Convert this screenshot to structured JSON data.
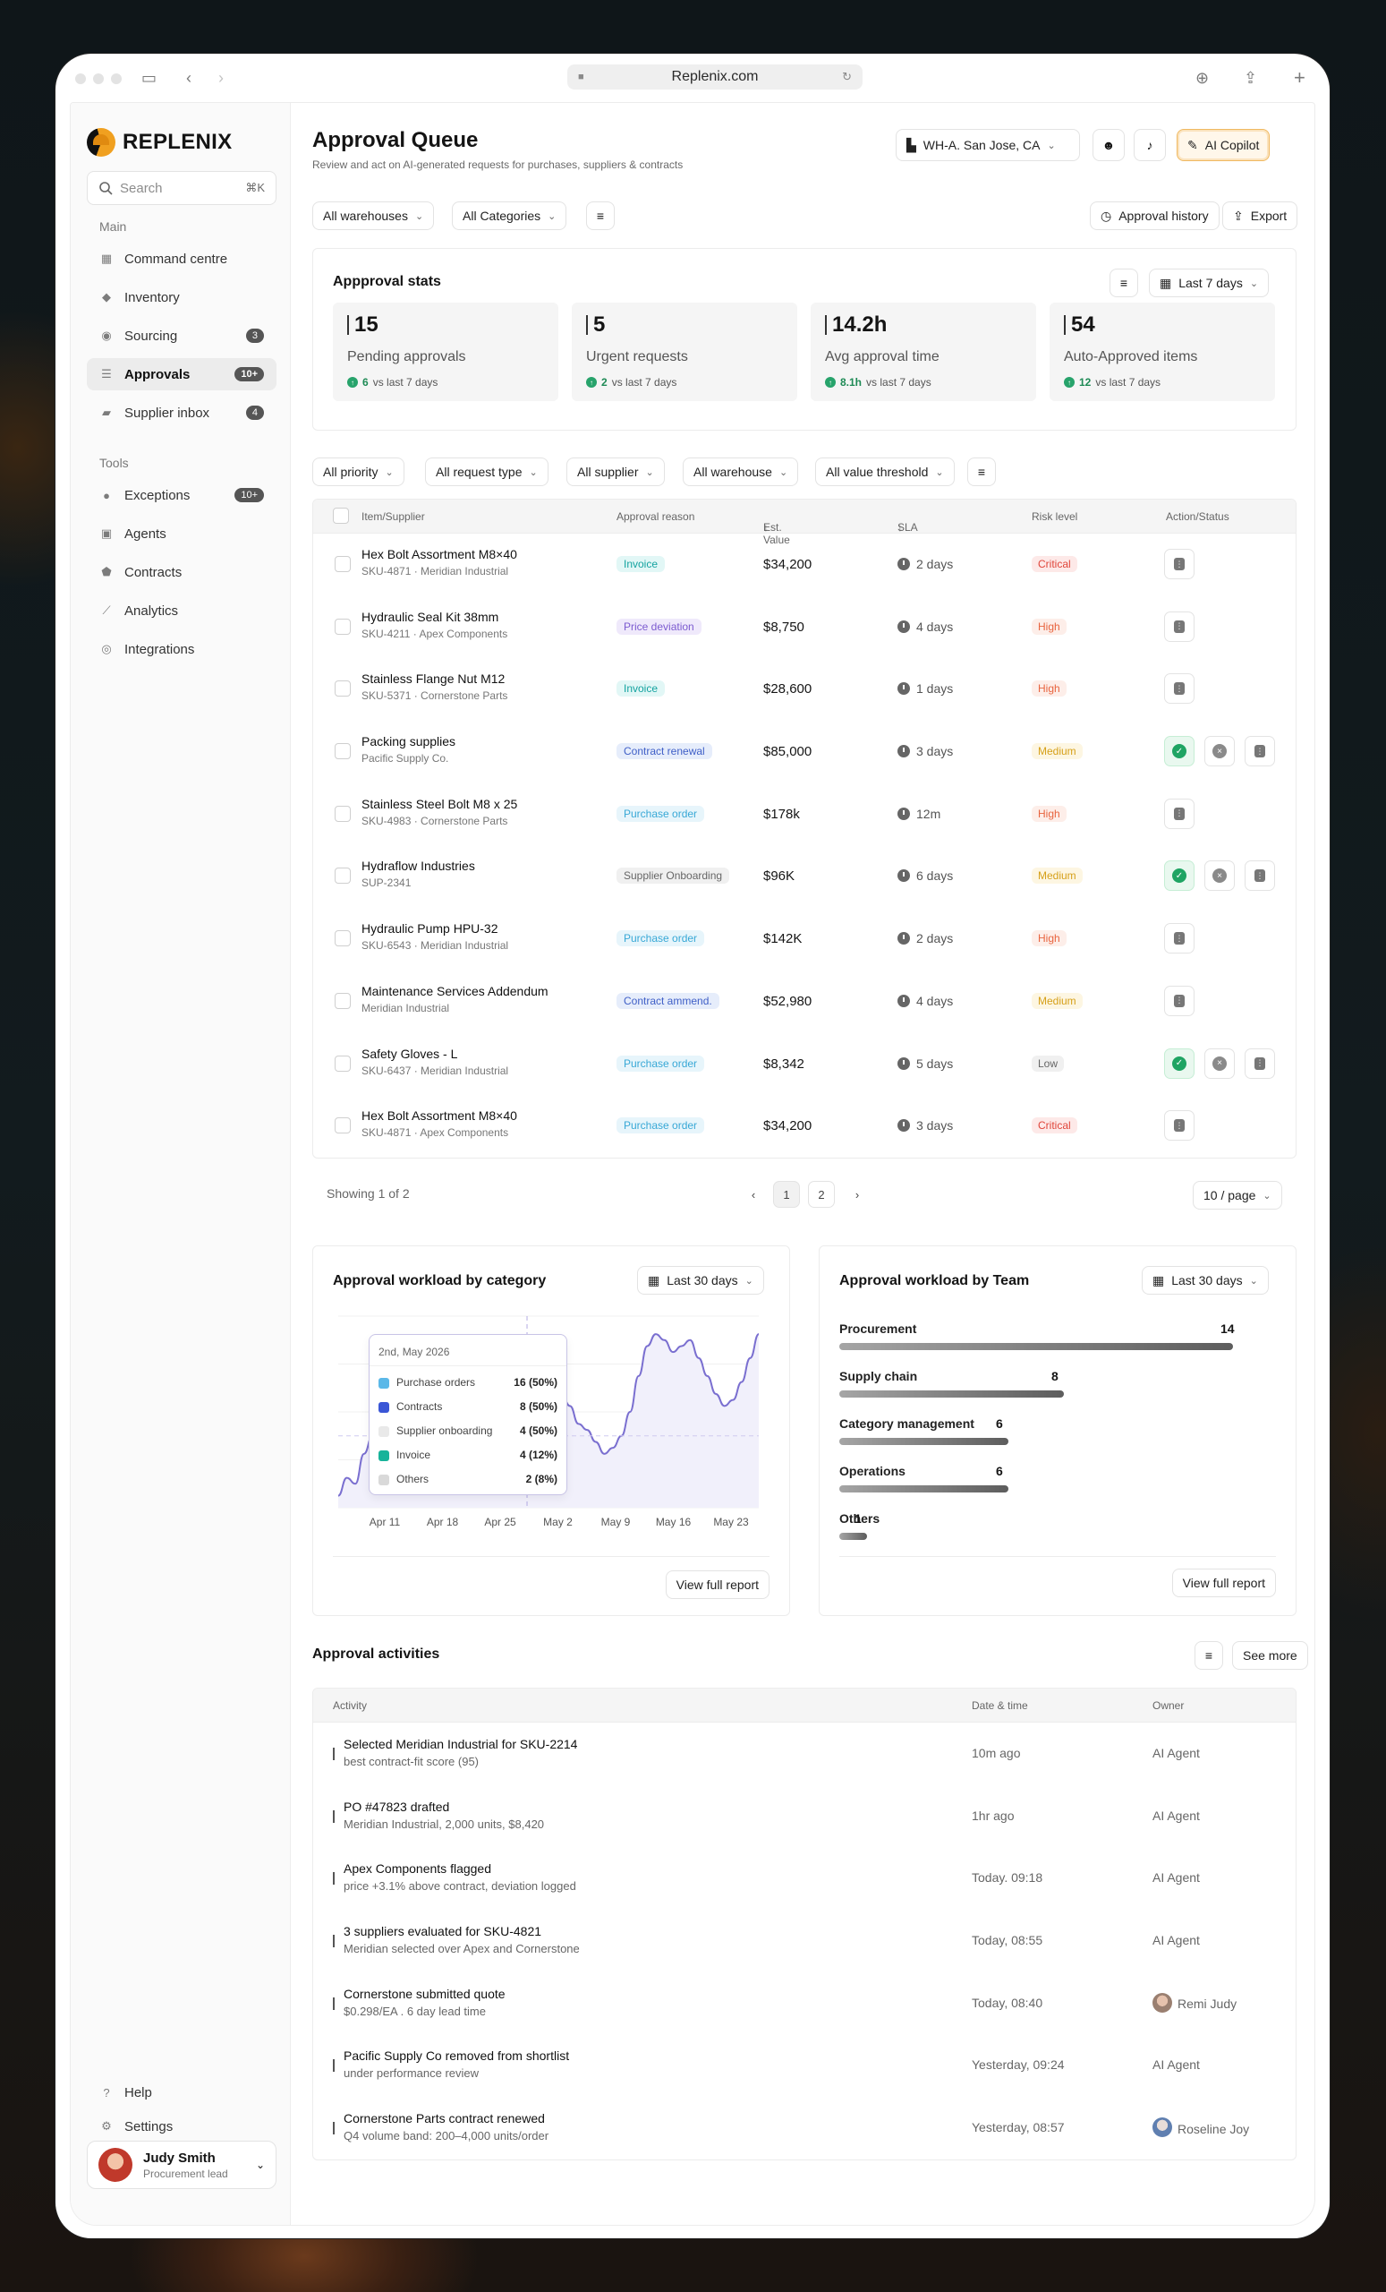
{
  "browser": {
    "url": "Replenix.com"
  },
  "brand": {
    "name": "REPLENIX"
  },
  "search": {
    "placeholder": "Search",
    "shortcut": "⌘K"
  },
  "sidebar": {
    "main_label": "Main",
    "tools_label": "Tools",
    "main_items": [
      {
        "label": "Command centre",
        "icon": "grid-icon"
      },
      {
        "label": "Inventory",
        "icon": "cube-icon"
      },
      {
        "label": "Sourcing",
        "icon": "sourcing-icon",
        "badge": "3"
      },
      {
        "label": "Approvals",
        "icon": "checklist-icon",
        "badge": "10+",
        "active": true
      },
      {
        "label": "Supplier inbox",
        "icon": "chat-icon",
        "badge": "4"
      }
    ],
    "tool_items": [
      {
        "label": "Exceptions",
        "icon": "alert-icon",
        "badge": "10+"
      },
      {
        "label": "Agents",
        "icon": "agent-icon"
      },
      {
        "label": "Contracts",
        "icon": "shield-icon"
      },
      {
        "label": "Analytics",
        "icon": "chart-icon"
      },
      {
        "label": "Integrations",
        "icon": "integration-icon"
      }
    ],
    "help": "Help",
    "settings": "Settings",
    "user": {
      "name": "Judy Smith",
      "role": "Procurement lead"
    }
  },
  "header": {
    "title": "Approval Queue",
    "subtitle": "Review and act on AI-generated requests for purchases, suppliers & contracts",
    "warehouse": "WH-A. San Jose, CA",
    "copilot": "AI Copilot"
  },
  "filters_top": {
    "warehouses": "All warehouses",
    "categories": "All Categories",
    "history": "Approval history",
    "export": "Export"
  },
  "stats": {
    "title": "Appproval stats",
    "range": "Last 7 days",
    "items": [
      {
        "value": "15",
        "label": "Pending approvals",
        "delta": "6",
        "delta_text": "vs last 7 days"
      },
      {
        "value": "5",
        "label": "Urgent requests",
        "delta": "2",
        "delta_text": "vs last 7 days"
      },
      {
        "value": "14.2h",
        "label": "Avg approval time",
        "delta": "8.1h",
        "delta_text": "vs last 7 days"
      },
      {
        "value": "54",
        "label": "Auto-Approved items",
        "delta": "12",
        "delta_text": "vs last 7 days"
      }
    ]
  },
  "filters_table": {
    "priority": "All priority",
    "request": "All request type",
    "supplier": "All supplier",
    "warehouse": "All warehouse",
    "threshold": "All value threshold"
  },
  "table": {
    "headers": {
      "item": "Item/Supplier",
      "reason": "Approval reason",
      "value": "Est. Value",
      "sla": "SLA",
      "risk": "Risk level",
      "action": "Action/Status"
    },
    "rows": [
      {
        "name": "Hex Bolt Assortment M8×40",
        "sub": "SKU-4871 · Meridian Industrial",
        "reason": "Invoice",
        "reason_kind": "teal",
        "value": "$34,200",
        "sla": "2 days",
        "risk": "Critical",
        "risk_kind": "critical",
        "actions": "more"
      },
      {
        "name": "Hydraulic Seal Kit 38mm",
        "sub": "SKU-4211 · Apex Components",
        "reason": "Price deviation",
        "reason_kind": "purple",
        "value": "$8,750",
        "sla": "4 days",
        "risk": "High",
        "risk_kind": "high",
        "actions": "more"
      },
      {
        "name": "Stainless Flange Nut M12",
        "sub": "SKU-5371 · Cornerstone Parts",
        "reason": "Invoice",
        "reason_kind": "teal",
        "value": "$28,600",
        "sla": "1 days",
        "risk": "High",
        "risk_kind": "high",
        "actions": "more"
      },
      {
        "name": "Packing supplies",
        "sub": "Pacific Supply Co.",
        "reason": "Contract renewal",
        "reason_kind": "indigo",
        "value": "$85,000",
        "sla": "3 days",
        "risk": "Medium",
        "risk_kind": "medium",
        "actions": "full"
      },
      {
        "name": "Stainless Steel Bolt M8 x 25",
        "sub": "SKU-4983 · Cornerstone Parts",
        "reason": "Purchase order",
        "reason_kind": "sky",
        "value": "$178k",
        "sla": "12m",
        "risk": "High",
        "risk_kind": "high",
        "actions": "more"
      },
      {
        "name": "Hydraflow Industries",
        "sub": "SUP-2341",
        "reason": "Supplier Onboarding",
        "reason_kind": "gray",
        "value": "$96K",
        "sla": "6 days",
        "risk": "Medium",
        "risk_kind": "medium",
        "actions": "full"
      },
      {
        "name": "Hydraulic Pump HPU-32",
        "sub": "SKU-6543 · Meridian Industrial",
        "reason": "Purchase order",
        "reason_kind": "sky",
        "value": "$142K",
        "sla": "2 days",
        "risk": "High",
        "risk_kind": "high",
        "actions": "more"
      },
      {
        "name": "Maintenance Services Addendum",
        "sub": "Meridian Industrial",
        "reason": "Contract ammend.",
        "reason_kind": "indigo",
        "value": "$52,980",
        "sla": "4 days",
        "risk": "Medium",
        "risk_kind": "medium",
        "actions": "more"
      },
      {
        "name": "Safety Gloves - L",
        "sub": "SKU-6437 · Meridian Industrial",
        "reason": "Purchase order",
        "reason_kind": "sky",
        "value": "$8,342",
        "sla": "5 days",
        "risk": "Low",
        "risk_kind": "low",
        "actions": "full"
      },
      {
        "name": "Hex Bolt Assortment M8×40",
        "sub": "SKU-4871 · Apex Components",
        "reason": "Purchase order",
        "reason_kind": "sky",
        "value": "$34,200",
        "sla": "3 days",
        "risk": "Critical",
        "risk_kind": "critical",
        "actions": "more"
      }
    ]
  },
  "pagination": {
    "showing": "Showing 1 of 2",
    "pages": [
      "1",
      "2"
    ],
    "per_page": "10 / page"
  },
  "workload_category": {
    "title": "Approval workload by category",
    "range": "Last 30 days",
    "tooltip": {
      "date": "2nd, May 2026",
      "rows": [
        {
          "label": "Purchase orders",
          "value": "16 (50%)",
          "color": "#5bb8e8"
        },
        {
          "label": "Contracts",
          "value": "8 (50%)",
          "color": "#3a56d6"
        },
        {
          "label": "Supplier onboarding",
          "value": "4 (50%)",
          "color": "#e9e9e9"
        },
        {
          "label": "Invoice",
          "value": "4 (12%)",
          "color": "#17b39a"
        },
        {
          "label": "Others",
          "value": "2 (8%)",
          "color": "#d9d9d9"
        }
      ]
    },
    "report": "View full report"
  },
  "workload_team": {
    "title": "Approval workload by Team",
    "range": "Last 30 days",
    "report": "View full report",
    "bars": [
      {
        "label": "Procurement",
        "value": 14
      },
      {
        "label": "Supply chain",
        "value": 8
      },
      {
        "label": "Category management",
        "value": 6
      },
      {
        "label": "Operations",
        "value": 6
      },
      {
        "label": "Others",
        "value": 1
      }
    ]
  },
  "chart_data": {
    "type": "area",
    "title": "Approval workload by category",
    "x_tick_labels": [
      "Apr 11",
      "Apr 18",
      "Apr 25",
      "May 2",
      "May 9",
      "May 16",
      "May 23"
    ],
    "x_start": "Apr 7",
    "x_end": "May 26",
    "series": [
      {
        "values": [
          2,
          5,
          4,
          9,
          12,
          17,
          22,
          24,
          21,
          18,
          15,
          13,
          14,
          17,
          20,
          22,
          23,
          21,
          18,
          16,
          15,
          13,
          12,
          11,
          13,
          16,
          19,
          17,
          14,
          13,
          11,
          9,
          10,
          12,
          16,
          22,
          27,
          29,
          28,
          26,
          27,
          28,
          25,
          22,
          19,
          17,
          18,
          21,
          25,
          29
        ]
      }
    ],
    "ylim": [
      0,
      32
    ],
    "grid": true,
    "tooltip_date": "May 2"
  },
  "activities": {
    "title": "Approval activities",
    "see_more": "See more",
    "headers": {
      "activity": "Activity",
      "date": "Date & time",
      "owner": "Owner"
    },
    "rows": [
      {
        "title": "Selected Meridian Industrial for SKU-2214",
        "sub": "best contract-fit score (95)",
        "date": "10m ago",
        "owner": "AI Agent"
      },
      {
        "title": "PO #47823 drafted",
        "sub": "Meridian Industrial, 2,000 units, $8,420",
        "date": "1hr ago",
        "owner": "AI Agent"
      },
      {
        "title": "Apex Components flagged",
        "sub": "price +3.1% above contract, deviation logged",
        "date": "Today. 09:18",
        "owner": "AI Agent"
      },
      {
        "title": "3 suppliers evaluated for SKU-4821",
        "sub": "Meridian selected over Apex and Cornerstone",
        "date": "Today, 08:55",
        "owner": "AI Agent"
      },
      {
        "title": "Cornerstone submitted quote",
        "sub": "$0.298/EA . 6 day lead time",
        "date": "Today, 08:40",
        "owner": "Remi Judy",
        "avatar": "a1"
      },
      {
        "title": "Pacific Supply Co removed from shortlist",
        "sub": "under performance review",
        "date": "Yesterday, 09:24",
        "owner": "AI Agent"
      },
      {
        "title": "Cornerstone Parts contract renewed",
        "sub": "Q4 volume band: 200–4,000 units/order",
        "date": "Yesterday, 08:57",
        "owner": "Roseline Joy",
        "avatar": "a2"
      }
    ]
  }
}
